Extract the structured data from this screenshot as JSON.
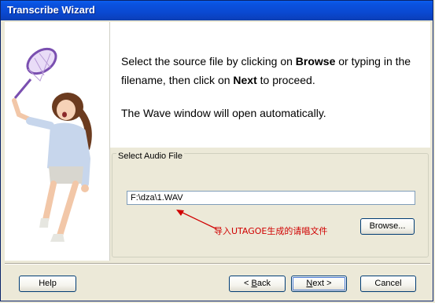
{
  "window": {
    "title": "Transcribe Wizard"
  },
  "content": {
    "instruction_parts": [
      "Select the source file by clicking on ",
      "Browse",
      " or typing in the filename, then click on ",
      "Next",
      " to proceed."
    ],
    "note": "The Wave window will open automatically."
  },
  "group": {
    "label": "Select Audio File",
    "file_value": "F:\\dza\\1.WAV",
    "browse_label": "Browse...",
    "annotation": "导入UTAGOE生成的请唱文件"
  },
  "footer": {
    "help_label": "Help",
    "back_arrow": "<",
    "back_mnemonic": "B",
    "back_rest": "ack",
    "next_mnemonic": "N",
    "next_rest": "ext",
    "next_arrow": ">",
    "cancel_label": "Cancel"
  },
  "colors": {
    "titlebar": "#0a49d2",
    "annotation": "#d00000",
    "net": "#8a5ab8",
    "pane": "#ffffff",
    "dialog": "#ece9d8"
  },
  "icons": [
    "illustration-girl-with-butterfly-net"
  ]
}
